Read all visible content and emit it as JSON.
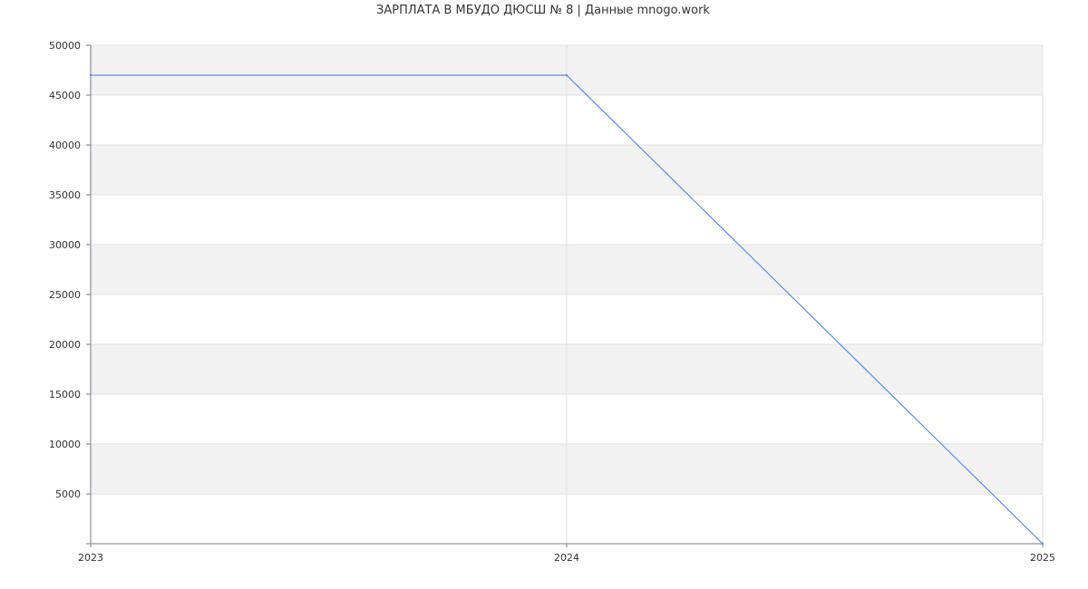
{
  "chart_data": {
    "type": "line",
    "title": "ЗАРПЛАТА В МБУДО ДЮСШ № 8 | Данные mnogo.work",
    "xlabel": "",
    "ylabel": "",
    "x": [
      "2023",
      "2024",
      "2025"
    ],
    "series": [
      {
        "values": [
          47000,
          47000,
          0
        ]
      }
    ],
    "ylim": [
      0,
      50000
    ],
    "y_ticks": [
      "5000",
      "10000",
      "15000",
      "20000",
      "25000",
      "30000",
      "35000",
      "40000",
      "45000",
      "50000"
    ],
    "x_ticks": [
      "2023",
      "2024",
      "2025"
    ],
    "grid": true,
    "legend": "none",
    "colors": {
      "line": "#5b8de6",
      "band": "#f2f2f2",
      "grid": "#e2e2e2",
      "axis": "#7a7a8a"
    }
  }
}
